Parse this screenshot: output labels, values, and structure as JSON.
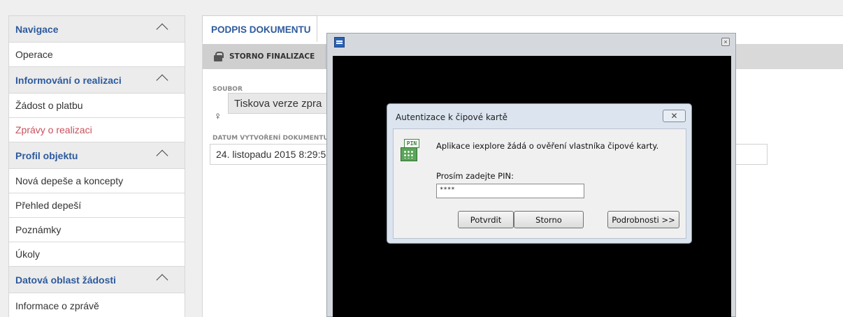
{
  "sidebar": {
    "sections": [
      {
        "title": "Navigace",
        "items": [
          "Operace"
        ]
      },
      {
        "title": "Informování o realizaci",
        "items": [
          "Žádost o platbu",
          "Zprávy o realizaci"
        ]
      },
      {
        "title": "Profil objektu",
        "items": [
          "Nová depeše a koncepty",
          "Přehled depeší",
          "Poznámky",
          "Úkoly"
        ]
      },
      {
        "title": "Datová oblast žádosti",
        "items": [
          "Informace o zprávě"
        ]
      }
    ],
    "active_item_color": "#c8505c"
  },
  "main": {
    "tab_label": "PODPIS DOKUMENTU",
    "toolbar_button": "STORNO FINALIZACE",
    "file_label": "SOUBOR",
    "file_value": "Tiskova verze zpra",
    "date_label": "DATUM VYTVOŘENÍ DOKUMENTU",
    "date_value": "24. listopadu 2015 8:29:5"
  },
  "popup": {
    "close_glyph": "×"
  },
  "pin_dialog": {
    "title": "Autentizace k čipové kartě",
    "close_glyph": "✕",
    "icon_text": "PIN",
    "message": "Aplikace iexplore žádá o ověření vlastníka čipové karty.",
    "pin_label": "Prosím zadejte PIN:",
    "pin_value": "****",
    "btn_confirm": "Potvrdit",
    "btn_cancel": "Storno",
    "btn_details": "Podrobnosti >>"
  }
}
